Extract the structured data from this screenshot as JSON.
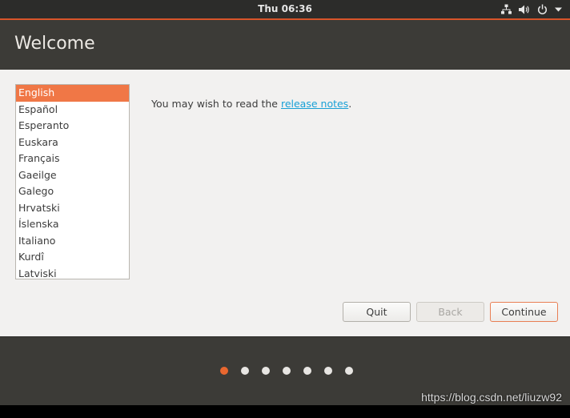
{
  "topbar": {
    "clock": "Thu 06:36",
    "icons": [
      "network-icon",
      "volume-icon",
      "power-icon",
      "menu-arrow-icon"
    ]
  },
  "window": {
    "title": "Welcome",
    "languages": [
      "English",
      "Español",
      "Esperanto",
      "Euskara",
      "Français",
      "Gaeilge",
      "Galego",
      "Hrvatski",
      "Íslenska",
      "Italiano",
      "Kurdî",
      "Latviski"
    ],
    "selected_language": "English",
    "notes_prefix": "You may wish to read the ",
    "notes_link": "release notes",
    "notes_suffix": ".",
    "buttons": {
      "quit": "Quit",
      "back": "Back",
      "continue": "Continue"
    },
    "back_enabled": false
  },
  "progress": {
    "total_steps": 7,
    "current_step": 1
  },
  "watermark": "https://blog.csdn.net/liuzw92",
  "colors": {
    "accent": "#e9672f",
    "selection": "#f07746",
    "header": "#3c3b37",
    "link": "#19a0d6"
  }
}
